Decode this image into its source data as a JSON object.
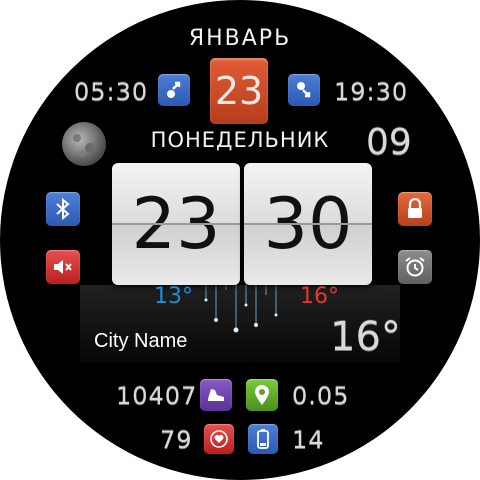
{
  "date": {
    "month": "ЯНВАРЬ",
    "day": "23",
    "weekday": "ПОНЕДЕЛЬНИК",
    "week_number": "09"
  },
  "sun": {
    "sunrise": "05:30",
    "sunset": "19:30"
  },
  "time": {
    "hours": "23",
    "minutes": "30"
  },
  "weather": {
    "temp_low": "13°",
    "temp_high": "16°",
    "current_temp": "16°",
    "city": "City Name"
  },
  "stats": {
    "steps": "10407",
    "distance": "0.05",
    "heart_rate": "79",
    "battery": "14"
  },
  "icons": {
    "sunrise": "sunrise-arrow-icon",
    "sunset": "sunset-arrow-icon",
    "moon": "moon-phase-icon",
    "bluetooth": "bluetooth-icon",
    "mute": "speaker-mute-icon",
    "lock": "lock-icon",
    "alarm": "alarm-clock-icon",
    "steps": "shoe-icon",
    "distance": "location-pin-icon",
    "heart": "heart-icon",
    "battery": "battery-icon"
  },
  "colors": {
    "low_temp": "#1a8fe0",
    "high_temp": "#e03a2a",
    "date_tile": "#cf4a28"
  }
}
